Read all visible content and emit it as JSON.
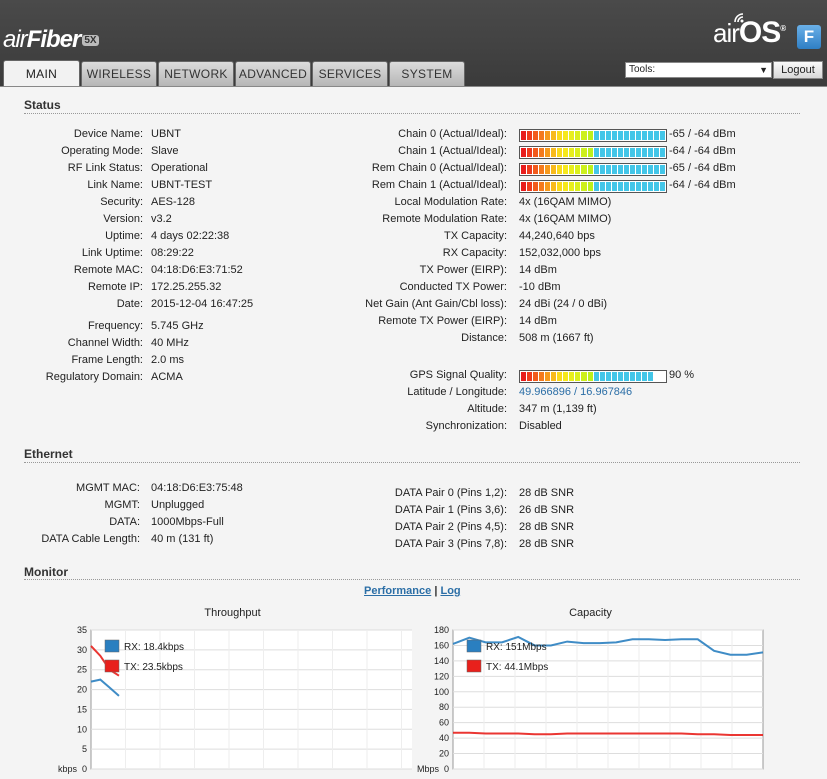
{
  "brand": {
    "product_a": "air",
    "product_b": "Fiber",
    "product_badge": "5X",
    "os_a": "air",
    "os_b": "OS",
    "os_mark": "®",
    "os_badge": "F"
  },
  "tabs": [
    "MAIN",
    "WIRELESS",
    "NETWORK",
    "ADVANCED",
    "SERVICES",
    "SYSTEM"
  ],
  "tools": {
    "label": "Tools:",
    "logout": "Logout"
  },
  "status": {
    "title": "Status",
    "left": [
      {
        "label": "Device Name:",
        "value": "UBNT"
      },
      {
        "label": "Operating Mode:",
        "value": "Slave"
      },
      {
        "label": "RF Link Status:",
        "value": "Operational"
      },
      {
        "label": "Link Name:",
        "value": "UBNT-TEST"
      },
      {
        "label": "Security:",
        "value": "AES-128"
      },
      {
        "label": "Version:",
        "value": "v3.2"
      },
      {
        "label": "Uptime:",
        "value": "4 days 02:22:38"
      },
      {
        "label": "Link Uptime:",
        "value": "08:29:22"
      },
      {
        "label": "Remote MAC:",
        "value": "04:18:D6:E3:71:52"
      },
      {
        "label": "Remote IP:",
        "value": "172.25.255.32"
      },
      {
        "label": "Date:",
        "value": "2015-12-04 16:47:25"
      }
    ],
    "left2": [
      {
        "label": "Frequency:",
        "value": "5.745 GHz"
      },
      {
        "label": "Channel Width:",
        "value": "40 MHz"
      },
      {
        "label": "Frame Length:",
        "value": "2.0 ms"
      },
      {
        "label": "Regulatory Domain:",
        "value": "ACMA"
      }
    ],
    "chains": [
      {
        "label": "Chain 0 (Actual/Ideal):",
        "value": "-65 / -64 dBm",
        "level": 1.0
      },
      {
        "label": "Chain 1 (Actual/Ideal):",
        "value": "-64 / -64 dBm",
        "level": 1.0
      },
      {
        "label": "Rem Chain 0 (Actual/Ideal):",
        "value": "-65 / -64 dBm",
        "level": 1.0
      },
      {
        "label": "Rem Chain 1 (Actual/Ideal):",
        "value": "-64 / -64 dBm",
        "level": 1.0
      }
    ],
    "right": [
      {
        "label": "Local Modulation Rate:",
        "value": "4x (16QAM MIMO)"
      },
      {
        "label": "Remote Modulation Rate:",
        "value": "4x (16QAM MIMO)"
      },
      {
        "label": "TX Capacity:",
        "value": "44,240,640 bps"
      },
      {
        "label": "RX Capacity:",
        "value": "152,032,000 bps"
      },
      {
        "label": "TX Power (EIRP):",
        "value": "14 dBm"
      },
      {
        "label": "Conducted TX Power:",
        "value": "-10 dBm"
      },
      {
        "label": "Net Gain (Ant Gain/Cbl loss):",
        "value": "24 dBi (24 / 0 dBi)"
      },
      {
        "label": "Remote TX Power (EIRP):",
        "value": "14 dBm"
      },
      {
        "label": "Distance:",
        "value": "508 m (1667 ft)"
      }
    ],
    "gps": {
      "label": "GPS Signal Quality:",
      "value": "90 %",
      "level": 0.9
    },
    "right2": [
      {
        "label": "Latitude / Longitude:",
        "value": "49.966896 / 16.967846"
      },
      {
        "label": "Altitude:",
        "value": "347 m (1,139 ft)"
      },
      {
        "label": "Synchronization:",
        "value": "Disabled"
      }
    ]
  },
  "ethernet": {
    "title": "Ethernet",
    "left": [
      {
        "label": "MGMT MAC:",
        "value": "04:18:D6:E3:75:48"
      },
      {
        "label": "MGMT:",
        "value": "Unplugged"
      },
      {
        "label": "DATA:",
        "value": "1000Mbps-Full"
      },
      {
        "label": "DATA Cable Length:",
        "value": "40 m (131 ft)"
      }
    ],
    "right": [
      {
        "label": "DATA Pair 0 (Pins 1,2):",
        "value": "28 dB SNR"
      },
      {
        "label": "DATA Pair 1 (Pins 3,6):",
        "value": "26 dB SNR"
      },
      {
        "label": "DATA Pair 2 (Pins 4,5):",
        "value": "28 dB SNR"
      },
      {
        "label": "DATA Pair 3 (Pins 7,8):",
        "value": "28 dB SNR"
      }
    ]
  },
  "monitor": {
    "title": "Monitor",
    "perf": "Performance",
    "sep": "|",
    "log": "Log"
  },
  "colors": {
    "accent": "#2b6ea6",
    "rx": "#2a7fc0",
    "tx": "#e8201c"
  },
  "chart_data": [
    {
      "type": "line",
      "title": "Throughput",
      "ylabel": "kbps",
      "yticks": [
        0,
        5,
        10,
        15,
        20,
        25,
        30,
        35
      ],
      "ylim": [
        0,
        35
      ],
      "x": [
        0,
        1,
        2,
        3
      ],
      "series": [
        {
          "name": "RX: 18.4kbps",
          "values": [
            22,
            22.5,
            20.5,
            18.4
          ]
        },
        {
          "name": "TX: 23.5kbps",
          "values": [
            31,
            28.5,
            25,
            23.5
          ]
        }
      ],
      "legend": "top-left",
      "grid": true
    },
    {
      "type": "line",
      "title": "Capacity",
      "ylabel": "Mbps",
      "yticks": [
        0,
        20,
        40,
        60,
        80,
        100,
        120,
        140,
        160,
        180
      ],
      "ylim": [
        0,
        180
      ],
      "x": [
        0,
        1,
        2,
        3,
        4,
        5,
        6,
        7,
        8,
        9,
        10,
        11,
        12,
        13,
        14,
        15,
        16,
        17,
        18,
        19
      ],
      "series": [
        {
          "name": "RX: 151Mbps",
          "values": [
            162,
            170,
            164,
            164,
            171,
            160,
            160,
            165,
            163,
            163,
            164,
            168,
            168,
            167,
            168,
            168,
            153,
            148,
            148,
            151
          ]
        },
        {
          "name": "TX: 44.1Mbps",
          "values": [
            47,
            47,
            46,
            46,
            46,
            45,
            45,
            46,
            46,
            46,
            46,
            46,
            46,
            46,
            46,
            45,
            45,
            44,
            44,
            44.1
          ]
        }
      ],
      "legend": "top-left",
      "grid": true
    }
  ]
}
